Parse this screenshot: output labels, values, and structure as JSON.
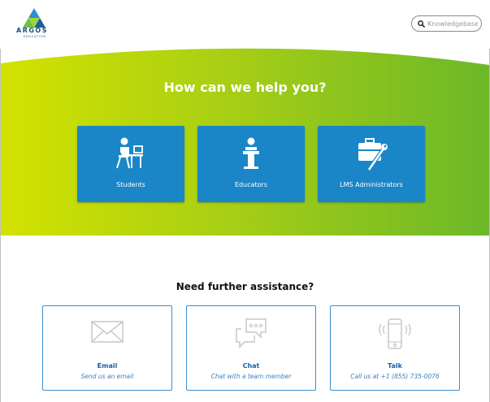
{
  "logo": {
    "name": "ARGOS",
    "tagline": "EDUCATION"
  },
  "search": {
    "placeholder": "Knowledgebase"
  },
  "hero": {
    "title": "How can we help you?",
    "cards": [
      {
        "label": "Students",
        "icon": "student-desk-icon"
      },
      {
        "label": "Educators",
        "icon": "podium-speaker-icon"
      },
      {
        "label": "LMS Administrators",
        "icon": "briefcase-wrench-icon"
      }
    ]
  },
  "assistance": {
    "title": "Need further assistance?",
    "cards": [
      {
        "title": "Email",
        "subtitle": "Send us an email",
        "icon": "envelope-icon"
      },
      {
        "title": "Chat",
        "subtitle": "Chat with a team member",
        "icon": "chat-bubbles-icon"
      },
      {
        "title": "Talk",
        "subtitle": "Call us at +1 (855) 735-0076",
        "icon": "phone-icon"
      }
    ]
  },
  "colors": {
    "card_blue": "#1a86c7",
    "hero_green_light": "#cfe000",
    "hero_green_dark": "#5fb52a",
    "link_blue": "#1a5fa0"
  }
}
